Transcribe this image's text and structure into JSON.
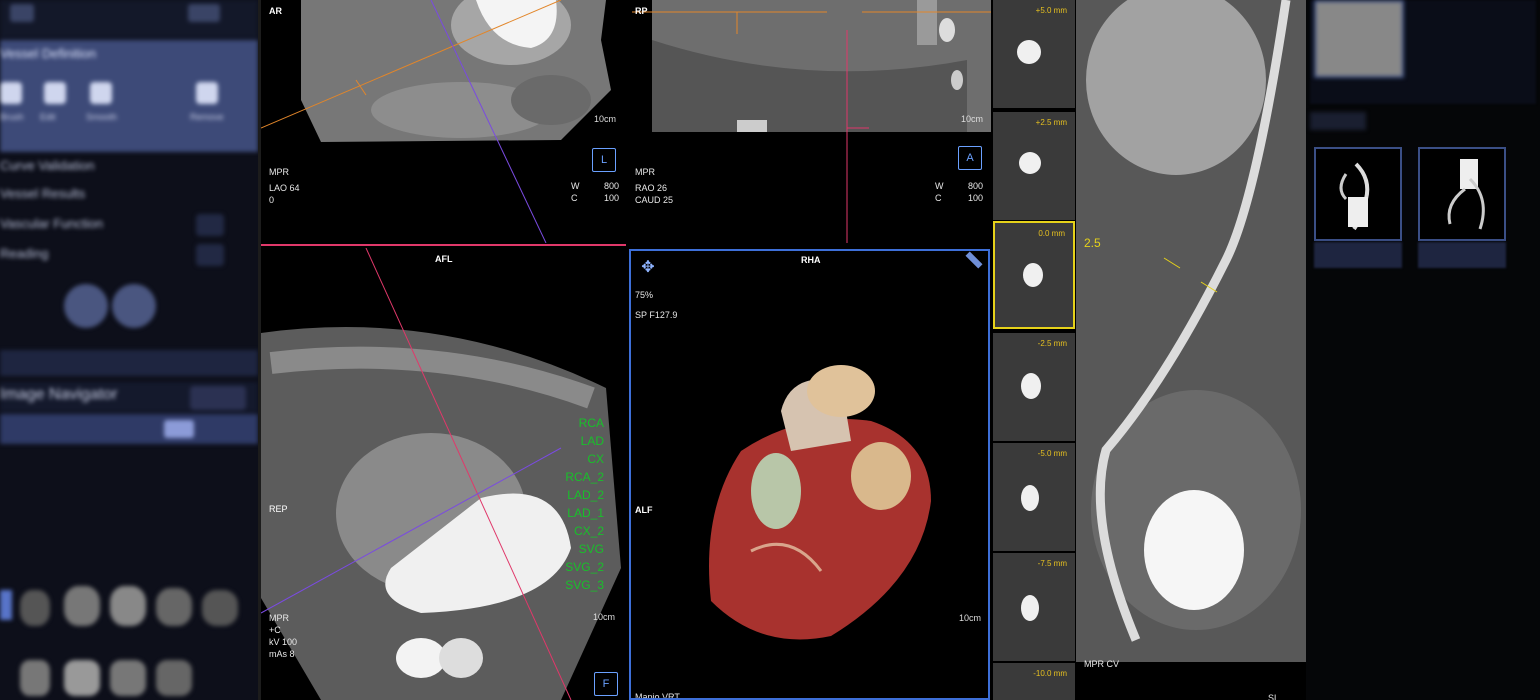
{
  "left_panel": {
    "items": [
      "Vessel Definition",
      "Curve Validation",
      "Vessel Results",
      "Vascular Function",
      "Reading",
      "Image Navigator"
    ],
    "tools": [
      "Brush",
      "Edit",
      "Smooth",
      "Remove"
    ]
  },
  "viewport_top_left": {
    "orientation": "AR",
    "method": "MPR",
    "angle1": "LAO 64",
    "angle2": "0",
    "w_label": "W",
    "w_value": "800",
    "c_label": "C",
    "c_value": "100",
    "scale": "10cm",
    "orient_icon": "L"
  },
  "viewport_top_mid": {
    "orientation": "RP",
    "method": "MPR",
    "angle1": "RAO 26",
    "angle2": "CAUD 25",
    "w_label": "W",
    "w_value": "800",
    "c_label": "C",
    "c_value": "100",
    "scale": "10cm",
    "orient_icon": "A"
  },
  "viewport_bottom_left": {
    "orientation_top": "AFL",
    "orientation_left": "REP",
    "method": "MPR",
    "contrast": "+C",
    "kv": "kV 100",
    "mas": "mAs 8",
    "scale": "10cm",
    "orient_icon": "F",
    "vessels": [
      "RCA",
      "LAD",
      "CX",
      "RCA_2",
      "LAD_2",
      "LAD_1",
      "CX_2",
      "SVG",
      "SVG_2",
      "SVG_3"
    ]
  },
  "viewport_bottom_mid": {
    "orientation_top": "RHA",
    "orientation_left": "ALF",
    "zoom": "75%",
    "position": "SP F127.9",
    "scale": "10cm",
    "mode": "Mapio VRT"
  },
  "slabs": [
    "+5.0 mm",
    "+2.5 mm",
    "0.0 mm",
    "-2.5 mm",
    "-5.0 mm",
    "-7.5 mm",
    "-10.0 mm"
  ],
  "curved_view": {
    "thickness": "2.5",
    "method": "MPR CV",
    "corner": "SL"
  },
  "colors": {
    "selected_slab": "#e6d21a",
    "vessel_label": "#18c02a",
    "active_border": "#3d6fd8",
    "sync_line": "#e0386a",
    "orange_line": "#e2862a",
    "purple_line": "#7a4be0"
  }
}
